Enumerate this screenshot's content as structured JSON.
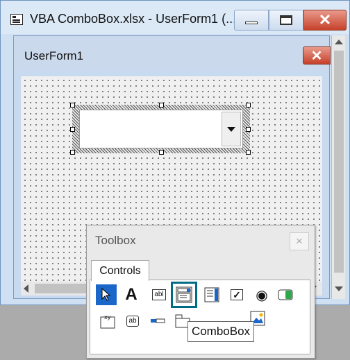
{
  "window": {
    "title": "VBA ComboBox.xlsx - UserForm1 (..."
  },
  "userform": {
    "title": "UserForm1"
  },
  "toolbox": {
    "title": "Toolbox",
    "close_glyph": "×",
    "tab_label": "Controls",
    "row1": [
      {
        "name": "select-objects-tool",
        "glyph": "➤",
        "selected": true
      },
      {
        "name": "label-tool",
        "glyph": "A"
      },
      {
        "name": "textbox-tool",
        "glyph": "abl"
      },
      {
        "name": "combobox-tool",
        "glyph": "▤",
        "highlighted": true
      },
      {
        "name": "listbox-tool",
        "glyph": "☰"
      },
      {
        "name": "checkbox-tool",
        "glyph": "✓"
      },
      {
        "name": "optionbutton-tool",
        "glyph": "◉"
      },
      {
        "name": "togglebutton-tool",
        "glyph": "▮"
      }
    ],
    "row2": [
      {
        "name": "frame-tool",
        "glyph": "xy"
      },
      {
        "name": "commandbutton-tool",
        "glyph": "ab"
      },
      {
        "name": "tabstrip-tool",
        "glyph": "▬"
      },
      {
        "name": "multipage-tool",
        "glyph": "▭"
      },
      {
        "name": "scrollbar-tool",
        "glyph": ""
      },
      {
        "name": "spinbutton-tool",
        "glyph": ""
      },
      {
        "name": "image-tool",
        "glyph": "▣"
      }
    ],
    "tooltip": "ComboBox"
  },
  "caption_buttons": {
    "close_glyph": "✕"
  },
  "colors": {
    "accent": "#1a66c9",
    "close_red": "#c6412a",
    "highlight_border": "#006b86"
  }
}
